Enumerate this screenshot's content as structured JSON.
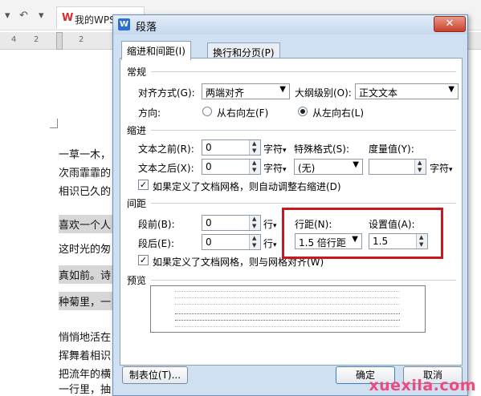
{
  "background": {
    "doc_tab_title": "我的WPS",
    "ruler_numbers": [
      "4",
      "2",
      "2"
    ],
    "doc_lines": [
      "一草一木，",
      "次雨霏霏的",
      "相识已久的",
      "喜欢一个人",
      "这时光的匆",
      "真如前。诗",
      "种菊里，一",
      "悄悄地活在",
      "挥舞着相识",
      "把流年的横",
      "一行里，抽"
    ]
  },
  "dialog": {
    "title": "段落",
    "close_glyph": "✕",
    "tabs": [
      "缩进和间距(I)",
      "换行和分页(P)"
    ],
    "general": {
      "section": "常规",
      "align_label": "对齐方式(G):",
      "align_value": "两端对齐",
      "outline_label": "大纲级别(O):",
      "outline_value": "正文文本",
      "direction_label": "方向:",
      "rtl_label": "从右向左(F)",
      "ltr_label": "从左向右(L)"
    },
    "indent": {
      "section": "缩进",
      "before_label": "文本之前(R):",
      "before_value": "0",
      "before_unit": "字符",
      "after_label": "文本之后(X):",
      "after_value": "0",
      "after_unit": "字符",
      "special_label": "特殊格式(S):",
      "special_value": "(无)",
      "measure_label": "度量值(Y):",
      "measure_value": "",
      "measure_unit": "字符",
      "grid_check_label": "如果定义了文档网格，则自动调整右缩进(D)"
    },
    "spacing": {
      "section": "间距",
      "before_label": "段前(B):",
      "before_value": "0",
      "before_unit": "行",
      "after_label": "段后(E):",
      "after_value": "0",
      "after_unit": "行",
      "line_label": "行距(N):",
      "line_value": "1.5 倍行距",
      "setting_label": "设置值(A):",
      "setting_value": "1.5",
      "grid_check_label": "如果定义了文档网格，则与网格对齐(W)"
    },
    "preview": {
      "section": "预览",
      "sample_text": "前一段落前一段落前一段落前一段落前一段落前一段落前一段落"
    },
    "buttons": {
      "tabs": "制表位(T)...",
      "ok": "确定",
      "cancel": "取消"
    },
    "accent_color": "#c9171d"
  },
  "watermark": "xuexila.com"
}
